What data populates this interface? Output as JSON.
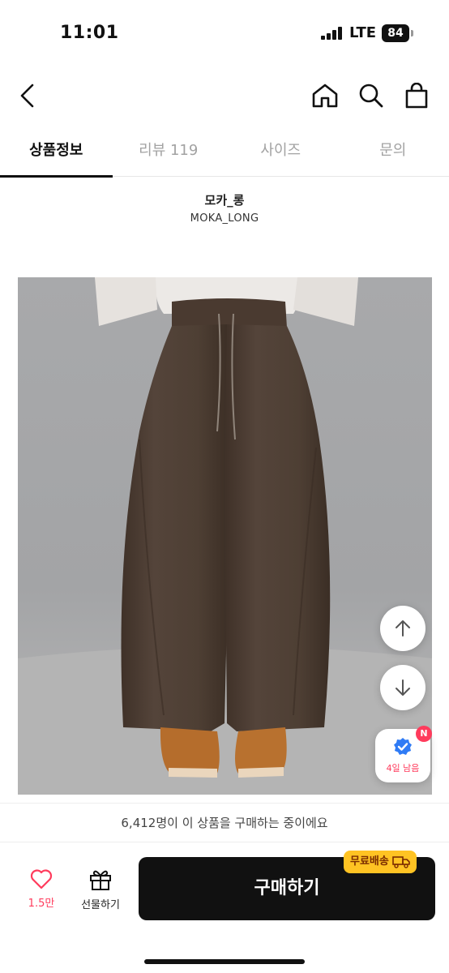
{
  "status_bar": {
    "time": "11:01",
    "network": "LTE",
    "battery": "84"
  },
  "header": {
    "back_icon": "chevron-left-icon",
    "home_icon": "home-icon",
    "search_icon": "search-icon",
    "cart_icon": "shopping-bag-icon"
  },
  "tabs": [
    {
      "label": "상품정보",
      "active": true
    },
    {
      "label": "리뷰 119",
      "active": false
    },
    {
      "label": "사이즈",
      "active": false
    },
    {
      "label": "문의",
      "active": false
    }
  ],
  "brand": {
    "name_ko": "모카_롱",
    "name_en": "MOKA_LONG"
  },
  "floating": {
    "scroll_up_icon": "arrow-up-icon",
    "scroll_down_icon": "arrow-down-icon",
    "coupon_badge": "N",
    "coupon_text": "4일 남음"
  },
  "notice": {
    "text": "6,412명이 이 상품을 구매하는 중이에요"
  },
  "bottom_bar": {
    "like_count": "1.5만",
    "gift_label": "선물하기",
    "free_shipping": "무료배송",
    "buy_label": "구매하기"
  },
  "colors": {
    "accent": "#ff3b5c",
    "primary": "#111111",
    "shipping_badge": "#ffc323",
    "pants": "#4d3e33"
  }
}
